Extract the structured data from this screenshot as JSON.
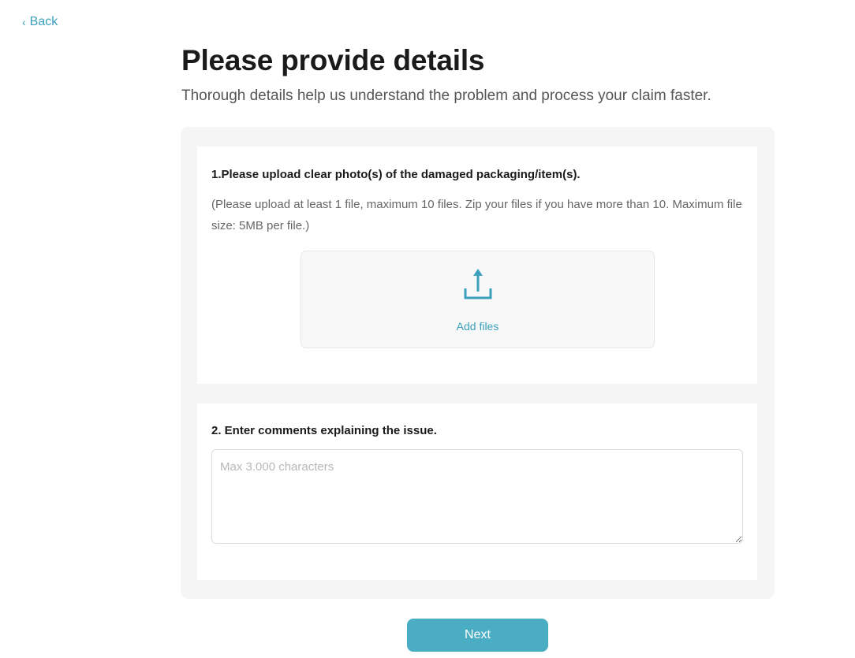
{
  "nav": {
    "back_chevron": "‹",
    "back_label": "Back"
  },
  "header": {
    "title": "Please provide details",
    "subtitle": "Thorough details help us understand the problem and process your claim faster."
  },
  "upload_section": {
    "heading": "1.Please upload clear photo(s) of the damaged packaging/item(s).",
    "hint": "(Please upload at least 1 file, maximum 10 files. Zip your files if you have more than 10. Maximum file size: 5MB per file.)",
    "icon": "upload-icon",
    "add_files_label": "Add files"
  },
  "comments_section": {
    "heading": "2. Enter comments explaining the issue.",
    "value": "",
    "placeholder": "Max 3.000 characters"
  },
  "actions": {
    "next_label": "Next"
  },
  "colors": {
    "accent": "#3aa0bd",
    "button": "#4badc4",
    "panel_bg": "#f5f5f5"
  }
}
